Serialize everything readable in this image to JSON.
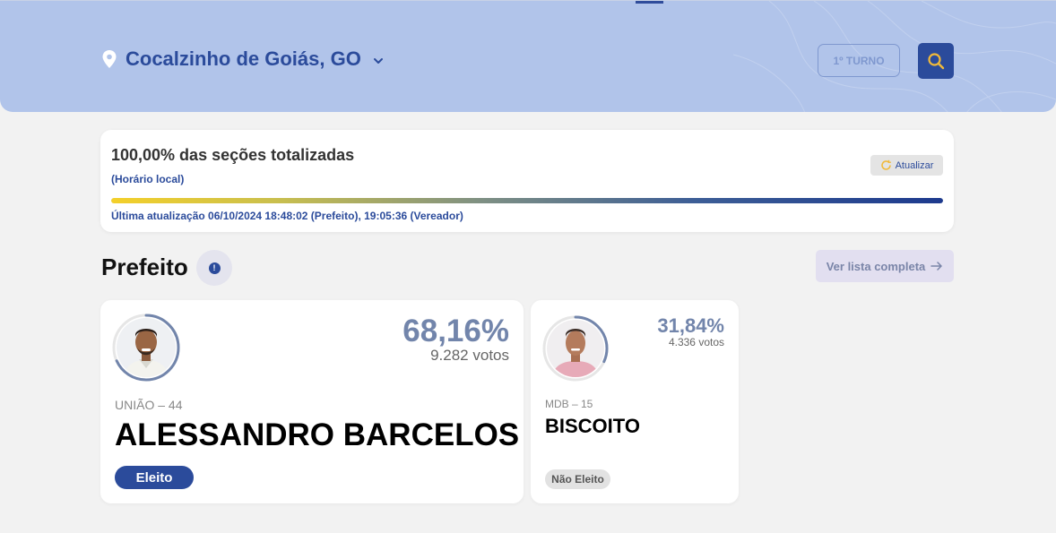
{
  "header": {
    "location": "Cocalzinho de Goiás, GO",
    "round_label": "1º TURNO",
    "icons": {
      "location": "map-pin-icon",
      "dropdown": "chevron-down-icon",
      "search": "search-icon"
    }
  },
  "status": {
    "title": "100,00% das seções totalizadas",
    "local_time_label": "(Horário local)",
    "refresh_label": "Atualizar",
    "progress_percent": 100,
    "last_update": "Última atualização 06/10/2024 18:48:02 (Prefeito), 19:05:36 (Vereador)"
  },
  "section": {
    "title": "Prefeito",
    "info_icon": "!",
    "full_list_label": "Ver lista completa"
  },
  "candidates": [
    {
      "percent": "68,16%",
      "votes": "9.282 votos",
      "party": "UNIÃO – 44",
      "name": "ALESSANDRO BARCELOS",
      "status": "Eleito",
      "vote_share": 0.6816
    },
    {
      "percent": "31,84%",
      "votes": "4.336 votos",
      "party": "MDB – 15",
      "name": "BISCOITO",
      "status": "Não Eleito",
      "vote_share": 0.3184
    }
  ],
  "colors": {
    "brand": "#2b4b9b",
    "header_bg": "#b1c4ea",
    "percent": "#7285ab",
    "progress_start": "#f4d02a",
    "progress_end": "#1d3a8e"
  }
}
